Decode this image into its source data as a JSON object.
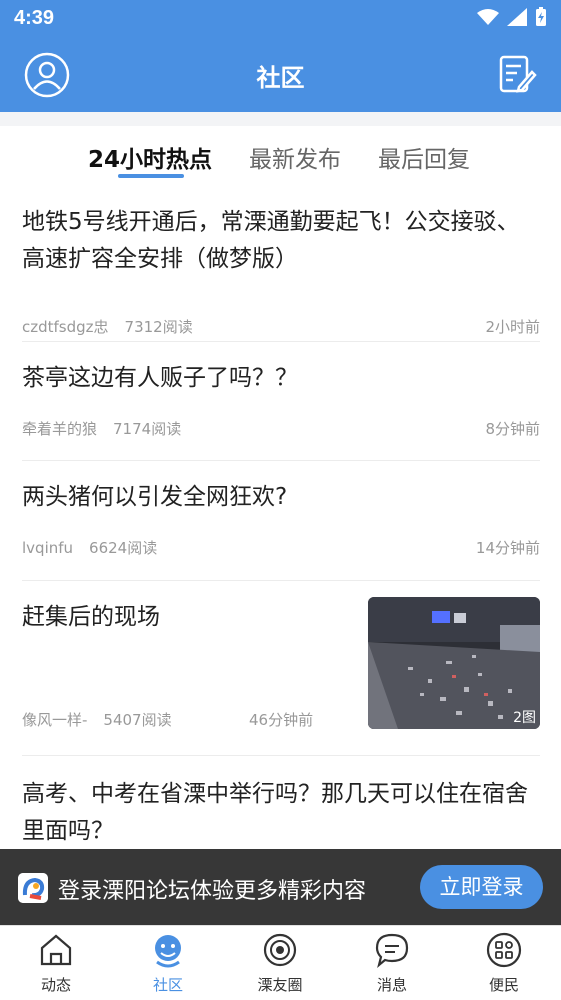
{
  "status_bar": {
    "time": "4:39"
  },
  "app_bar": {
    "title": "社区",
    "icons": [
      "user-avatar-icon",
      "compose-icon"
    ]
  },
  "tabs": [
    {
      "label": "24小时热点",
      "active": true
    },
    {
      "label": "最新发布",
      "active": false
    },
    {
      "label": "最后回复",
      "active": false
    }
  ],
  "posts": [
    {
      "title": "地铁5号线开通后，常溧通勤要起飞！公交接驳、高速扩容全安排（做梦版）",
      "author": "czdtfsdgz忠",
      "reads": "7312阅读",
      "time": "2小时前"
    },
    {
      "title": "茶亭这边有人贩子了吗？？",
      "author": "牵着羊的狼",
      "reads": "7174阅读",
      "time": "8分钟前"
    },
    {
      "title": "两头猪何以引发全网狂欢?",
      "author": "lvqinfu",
      "reads": "6624阅读",
      "time": "14分钟前"
    },
    {
      "title": "赶集后的现场",
      "author": "像风一样-",
      "reads": "5407阅读",
      "time": "46分钟前",
      "image_count": "2图"
    },
    {
      "title": "高考、中考在省溧中举行吗？那几天可以住在宿舍里面吗？"
    }
  ],
  "login_banner": {
    "message": "登录溧阳论坛体验更多精彩内容",
    "button": "立即登录"
  },
  "bottom_nav": [
    {
      "label": "动态",
      "icon": "home-icon",
      "active": false
    },
    {
      "label": "社区",
      "icon": "community-icon",
      "active": true
    },
    {
      "label": "溧友圈",
      "icon": "circle-icon",
      "active": false
    },
    {
      "label": "消息",
      "icon": "message-icon",
      "active": false
    },
    {
      "label": "便民",
      "icon": "services-icon",
      "active": false
    }
  ],
  "colors": {
    "brand": "#4a90e2",
    "text": "#222222",
    "meta": "#999999"
  }
}
